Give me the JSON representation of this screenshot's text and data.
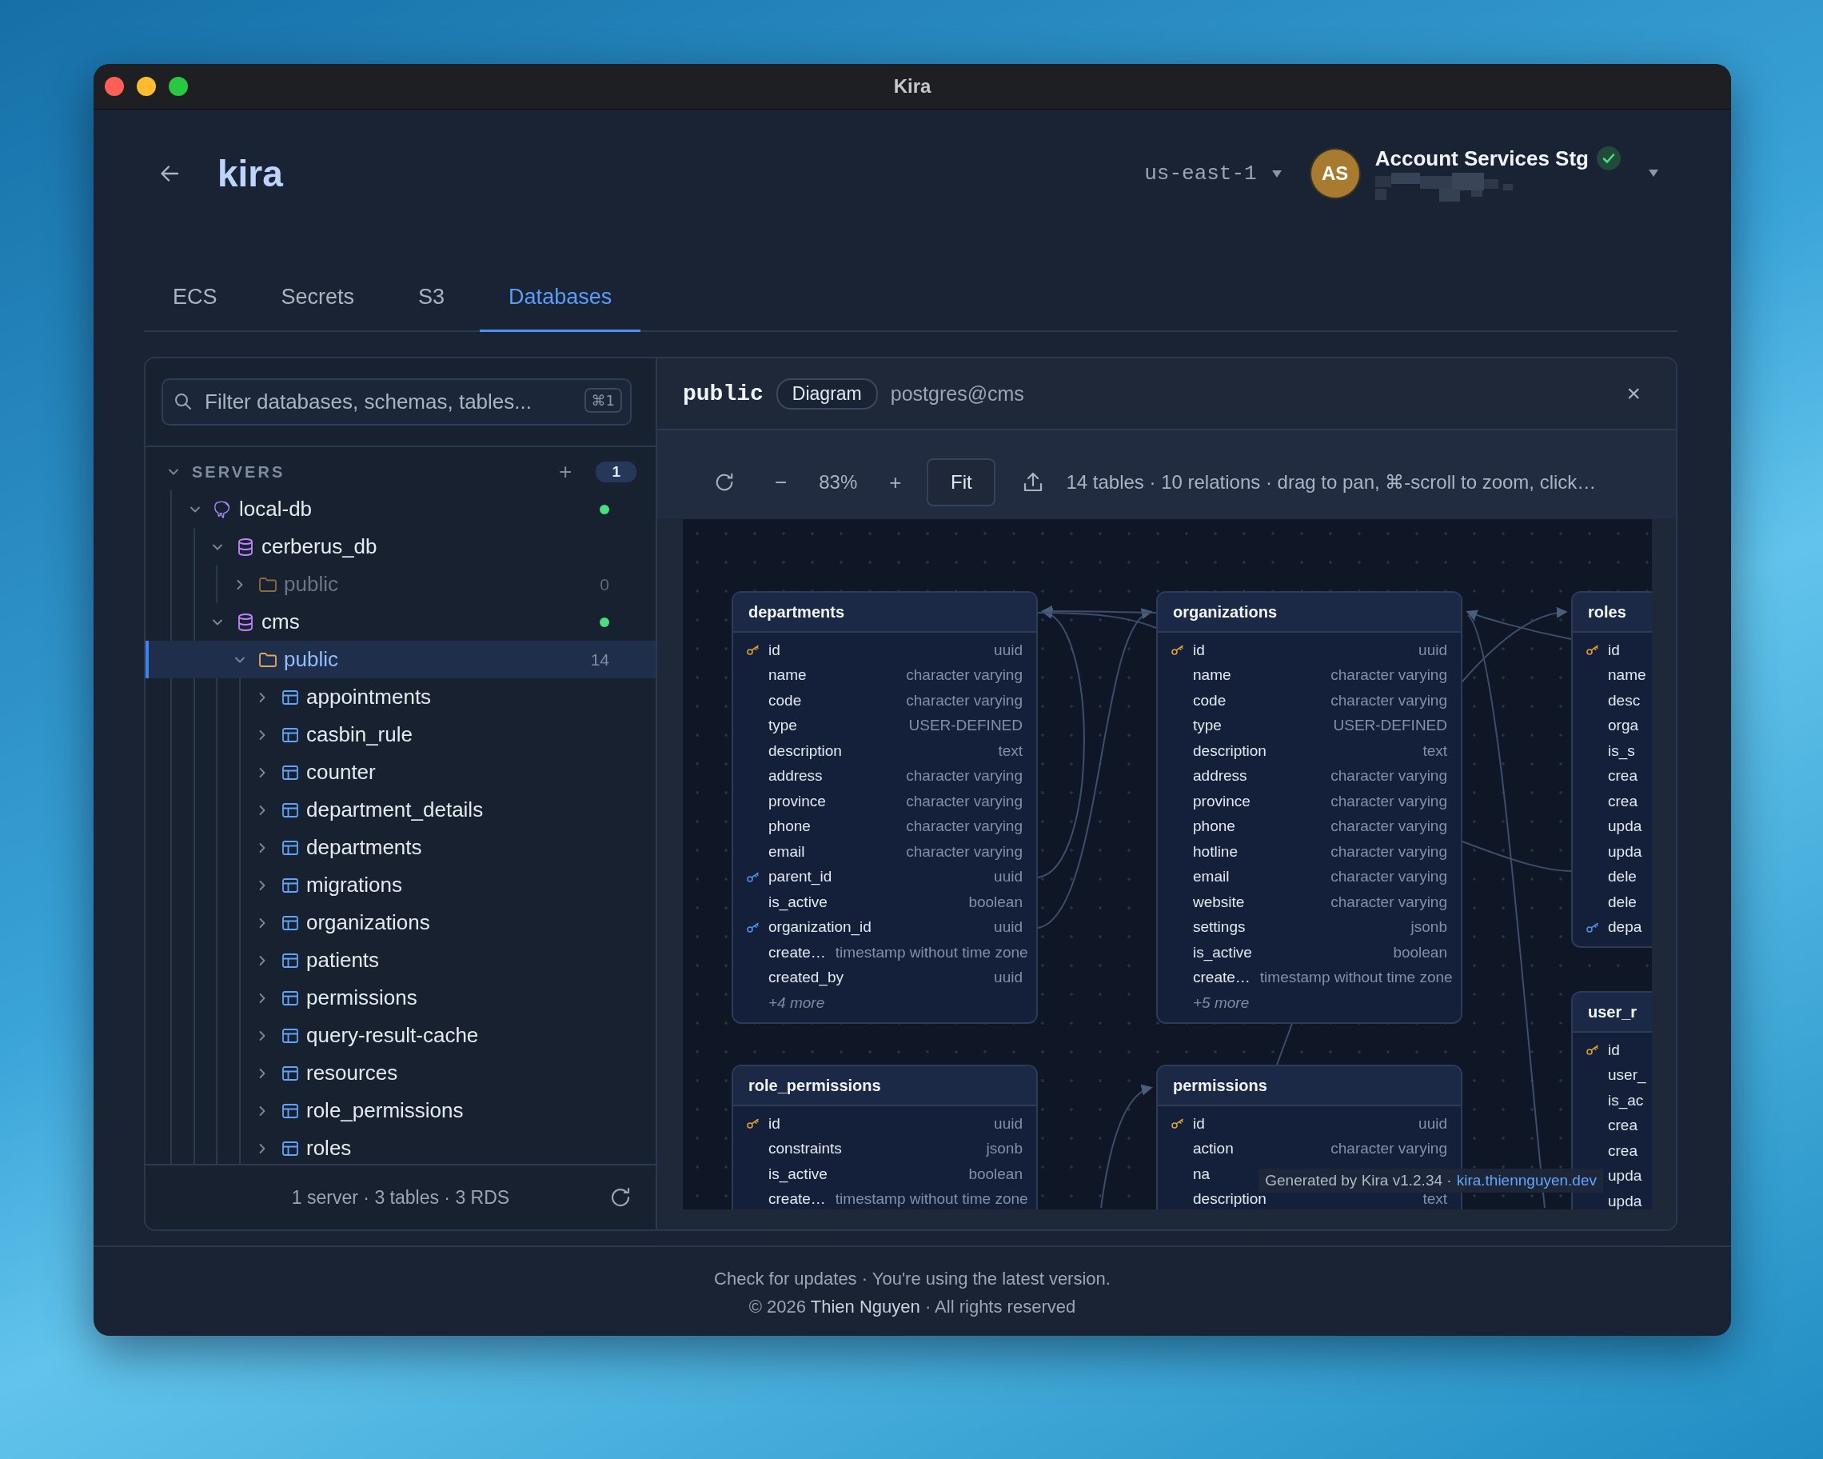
{
  "window": {
    "title": "Kira"
  },
  "header": {
    "app_name": "kira",
    "region": "us-east-1",
    "account": {
      "initials": "AS",
      "name": "Account Services Stg",
      "verified": true
    }
  },
  "tabs": [
    {
      "label": "ECS",
      "selected": false
    },
    {
      "label": "Secrets",
      "selected": false
    },
    {
      "label": "S3",
      "selected": false
    },
    {
      "label": "Databases",
      "selected": true
    }
  ],
  "sidebar": {
    "search": {
      "placeholder": "Filter databases, schemas, tables...",
      "shortcut": "⌘1"
    },
    "section": {
      "title": "SERVERS",
      "expanded": true,
      "add": "+",
      "count": "1"
    },
    "tree": [
      {
        "label": "local-db",
        "kind": "server",
        "expanded": true,
        "selected": false,
        "connected": true,
        "children": [
          {
            "label": "cerberus_db",
            "kind": "database",
            "expanded": true,
            "selected": false,
            "connected": false,
            "children": [
              {
                "label": "public",
                "kind": "schema",
                "expanded": false,
                "selected": false,
                "disabled": true,
                "count": "0"
              }
            ]
          },
          {
            "label": "cms",
            "kind": "database",
            "expanded": true,
            "selected": false,
            "connected": true,
            "children": [
              {
                "label": "public",
                "kind": "schema",
                "expanded": true,
                "selected": true,
                "disabled": false,
                "count": "14",
                "children": [
                  {
                    "label": "appointments",
                    "kind": "table",
                    "expanded": false,
                    "selected": false
                  },
                  {
                    "label": "casbin_rule",
                    "kind": "table",
                    "expanded": false,
                    "selected": false
                  },
                  {
                    "label": "counter",
                    "kind": "table",
                    "expanded": false,
                    "selected": false
                  },
                  {
                    "label": "department_details",
                    "kind": "table",
                    "expanded": false,
                    "selected": false
                  },
                  {
                    "label": "departments",
                    "kind": "table",
                    "expanded": false,
                    "selected": false
                  },
                  {
                    "label": "migrations",
                    "kind": "table",
                    "expanded": false,
                    "selected": false
                  },
                  {
                    "label": "organizations",
                    "kind": "table",
                    "expanded": false,
                    "selected": false
                  },
                  {
                    "label": "patients",
                    "kind": "table",
                    "expanded": false,
                    "selected": false
                  },
                  {
                    "label": "permissions",
                    "kind": "table",
                    "expanded": false,
                    "selected": false
                  },
                  {
                    "label": "query-result-cache",
                    "kind": "table",
                    "expanded": false,
                    "selected": false
                  },
                  {
                    "label": "resources",
                    "kind": "table",
                    "expanded": false,
                    "selected": false
                  },
                  {
                    "label": "role_permissions",
                    "kind": "table",
                    "expanded": false,
                    "selected": false
                  },
                  {
                    "label": "roles",
                    "kind": "table",
                    "expanded": false,
                    "selected": false
                  }
                ]
              }
            ]
          }
        ]
      }
    ],
    "footer": "1 server · 3 tables · 3 RDS"
  },
  "diagram": {
    "schema": "public",
    "mode": "Diagram",
    "connection": "postgres@cms",
    "close": "×",
    "toolbar": {
      "zoom_out": "−",
      "zoom": "83%",
      "zoom_in": "+",
      "fit": "Fit",
      "summary": "14 tables · 10 relations · drag to pan, ⌘-scroll to zoom, click…"
    },
    "tables": [
      {
        "name": "departments",
        "more": "+4 more",
        "columns": [
          {
            "name": "id",
            "type": "uuid",
            "kind": "primary_key"
          },
          {
            "name": "name",
            "type": "character varying",
            "kind": "column"
          },
          {
            "name": "code",
            "type": "character varying",
            "kind": "column"
          },
          {
            "name": "type",
            "type": "USER-DEFINED",
            "kind": "column"
          },
          {
            "name": "description",
            "type": "text",
            "kind": "column"
          },
          {
            "name": "address",
            "type": "character varying",
            "kind": "column"
          },
          {
            "name": "province",
            "type": "character varying",
            "kind": "column"
          },
          {
            "name": "phone",
            "type": "character varying",
            "kind": "column"
          },
          {
            "name": "email",
            "type": "character varying",
            "kind": "column"
          },
          {
            "name": "parent_id",
            "type": "uuid",
            "kind": "foreign_key"
          },
          {
            "name": "is_active",
            "type": "boolean",
            "kind": "column"
          },
          {
            "name": "organization_id",
            "type": "uuid",
            "kind": "foreign_key"
          },
          {
            "name": "create…",
            "type": "timestamp without time zone",
            "kind": "column"
          },
          {
            "name": "created_by",
            "type": "uuid",
            "kind": "column"
          }
        ]
      },
      {
        "name": "organizations",
        "more": "+5 more",
        "columns": [
          {
            "name": "id",
            "type": "uuid",
            "kind": "primary_key"
          },
          {
            "name": "name",
            "type": "character varying",
            "kind": "column"
          },
          {
            "name": "code",
            "type": "character varying",
            "kind": "column"
          },
          {
            "name": "type",
            "type": "USER-DEFINED",
            "kind": "column"
          },
          {
            "name": "description",
            "type": "text",
            "kind": "column"
          },
          {
            "name": "address",
            "type": "character varying",
            "kind": "column"
          },
          {
            "name": "province",
            "type": "character varying",
            "kind": "column"
          },
          {
            "name": "phone",
            "type": "character varying",
            "kind": "column"
          },
          {
            "name": "hotline",
            "type": "character varying",
            "kind": "column"
          },
          {
            "name": "email",
            "type": "character varying",
            "kind": "column"
          },
          {
            "name": "website",
            "type": "character varying",
            "kind": "column"
          },
          {
            "name": "settings",
            "type": "jsonb",
            "kind": "column"
          },
          {
            "name": "is_active",
            "type": "boolean",
            "kind": "column"
          },
          {
            "name": "create…",
            "type": "timestamp without time zone",
            "kind": "column"
          }
        ]
      },
      {
        "name": "roles",
        "columns": [
          {
            "name": "id",
            "kind": "primary_key"
          },
          {
            "name": "name",
            "kind": "column"
          },
          {
            "name": "desc",
            "kind": "column"
          },
          {
            "name": "orga",
            "kind": "column"
          },
          {
            "name": "is_s",
            "kind": "column"
          },
          {
            "name": "crea",
            "kind": "column"
          },
          {
            "name": "crea",
            "kind": "column"
          },
          {
            "name": "upda",
            "kind": "column"
          },
          {
            "name": "upda",
            "kind": "column"
          },
          {
            "name": "dele",
            "kind": "column"
          },
          {
            "name": "dele",
            "kind": "column"
          },
          {
            "name": "depa",
            "kind": "foreign_key"
          }
        ]
      },
      {
        "name": "role_permissions",
        "columns": [
          {
            "name": "id",
            "type": "uuid",
            "kind": "primary_key"
          },
          {
            "name": "constraints",
            "type": "jsonb",
            "kind": "column"
          },
          {
            "name": "is_active",
            "type": "boolean",
            "kind": "column"
          },
          {
            "name": "create…",
            "type": "timestamp without time zone",
            "kind": "column"
          }
        ]
      },
      {
        "name": "permissions",
        "columns": [
          {
            "name": "id",
            "type": "uuid",
            "kind": "primary_key"
          },
          {
            "name": "action",
            "type": "character varying",
            "kind": "column"
          },
          {
            "name": "na",
            "kind": "column"
          },
          {
            "name": "description",
            "type": "text",
            "kind": "column"
          }
        ]
      },
      {
        "name": "user_r",
        "columns": [
          {
            "name": "id",
            "kind": "primary_key"
          },
          {
            "name": "user_",
            "kind": "column"
          },
          {
            "name": "is_ac",
            "kind": "column"
          },
          {
            "name": "crea",
            "kind": "column"
          },
          {
            "name": "crea",
            "kind": "column"
          },
          {
            "name": "upda",
            "kind": "column"
          },
          {
            "name": "upda",
            "kind": "column"
          }
        ]
      }
    ],
    "credit": {
      "text": "Generated by Kira v1.2.34 ·",
      "link": "kira.thiennguyen.dev"
    }
  },
  "footer": {
    "check_updates": "Check for updates",
    "status": "· You're using the latest version.",
    "copyright": "© 2026",
    "author": "Thien Nguyen",
    "rights": "· All rights reserved"
  }
}
